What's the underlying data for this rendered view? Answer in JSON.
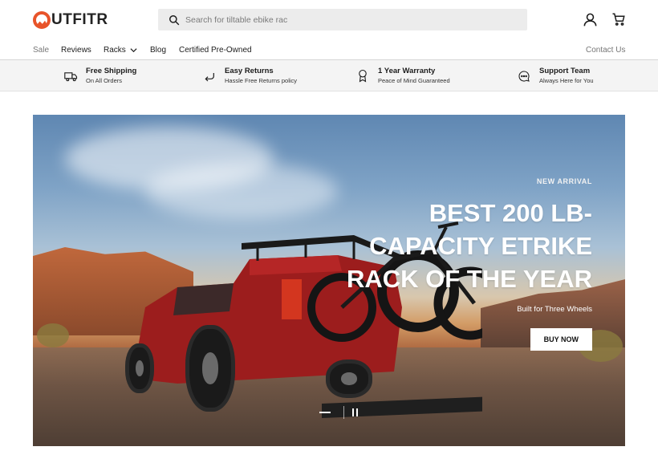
{
  "brand": {
    "logo_text": "UTFITR",
    "accent": "#e8542a"
  },
  "search": {
    "placeholder": "Search for tiltable ebike rac"
  },
  "header": {
    "account_icon": "account-icon",
    "cart_icon": "cart-icon"
  },
  "nav": {
    "items": [
      {
        "label": "Sale"
      },
      {
        "label": "Reviews"
      },
      {
        "label": "Racks"
      },
      {
        "label": "Blog"
      },
      {
        "label": "Certified Pre-Owned"
      }
    ],
    "contact": "Contact Us"
  },
  "usps": [
    {
      "title": "Free Shipping",
      "subtitle": "On All Orders",
      "icon": "truck-icon"
    },
    {
      "title": "Easy Returns",
      "subtitle": "Hassle Free Returns policy",
      "icon": "return-arrow-icon"
    },
    {
      "title": "1 Year Warranty",
      "subtitle": "Peace of Mind Guaranteed",
      "icon": "award-ribbon-icon"
    },
    {
      "title": "Support Team",
      "subtitle": "Always Here for You",
      "icon": "chat-bubble-icon"
    }
  ],
  "hero": {
    "eyebrow": "NEW ARRIVAL",
    "headline_line1": "BEST 200 LB-",
    "headline_line2": "CAPACITY ETRIKE",
    "headline_line3": "RACK OF THE YEAR",
    "subhead": "Built for Three Wheels",
    "cta": "BUY NOW"
  }
}
